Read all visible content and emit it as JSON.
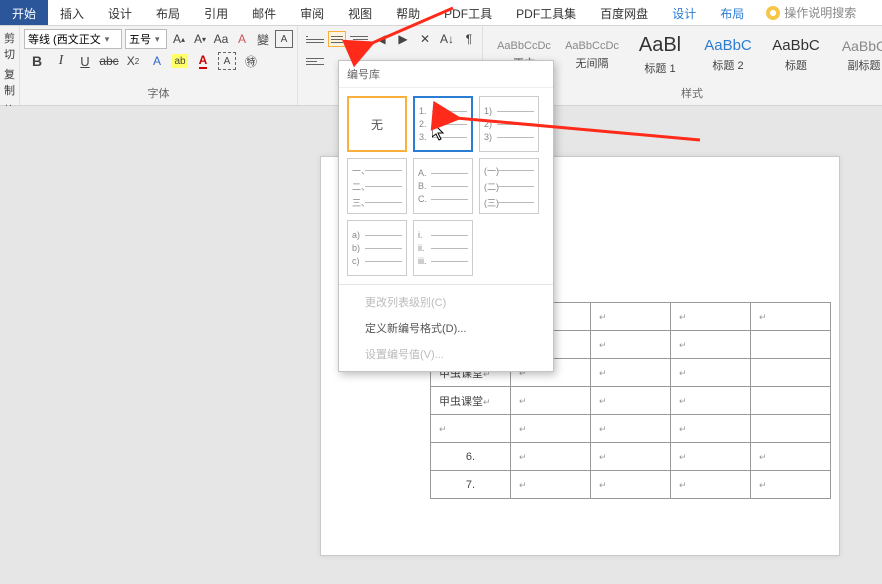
{
  "tabs": {
    "home": "开始",
    "insert": "插入",
    "design": "设计",
    "layout": "布局",
    "ref": "引用",
    "mail": "邮件",
    "review": "审阅",
    "view": "视图",
    "help": "帮助",
    "pdf1": "PDF工具",
    "pdf2": "PDF工具集",
    "baidu": "百度网盘",
    "tool_design": "设计",
    "tool_layout": "布局",
    "tellme": "操作说明搜索"
  },
  "clipboard": {
    "cut": "剪切",
    "copy": "复制",
    "painter": "格式刷"
  },
  "font": {
    "name": "等线 (西文正文",
    "size": "五号",
    "group_label": "字体"
  },
  "styles": {
    "group_label": "样式",
    "items": [
      {
        "preview": "AaBbCcDc",
        "name": "正文"
      },
      {
        "preview": "AaBbCcDc",
        "name": "无间隔"
      },
      {
        "preview": "AaBl",
        "name": "标题 1"
      },
      {
        "preview": "AaBbC",
        "name": "标题 2"
      },
      {
        "preview": "AaBbC",
        "name": "标题"
      },
      {
        "preview": "AaBbC",
        "name": "副标题"
      }
    ]
  },
  "dropdown": {
    "title": "编号库",
    "none": "无",
    "menus": {
      "change_level": "更改列表级别(C)",
      "define_new": "定义新编号格式(D)...",
      "set_value": "设置编号值(V)..."
    }
  },
  "table": {
    "text": "甲虫课堂",
    "rows": [
      "6.",
      "7."
    ]
  }
}
